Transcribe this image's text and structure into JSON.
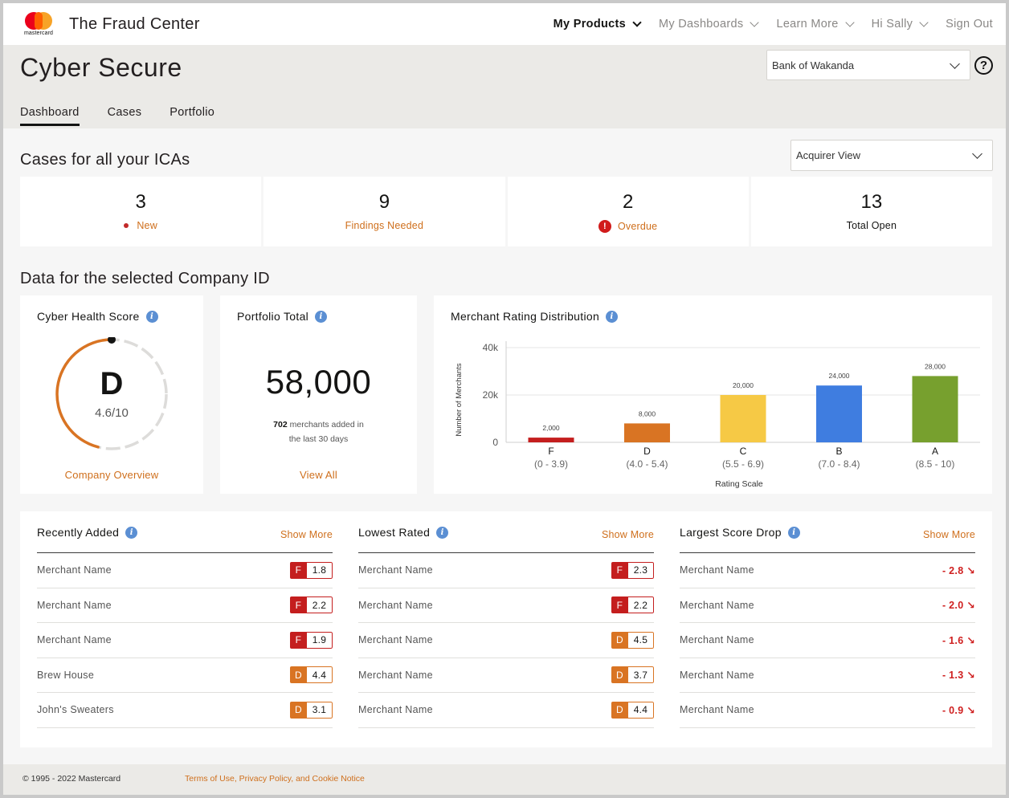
{
  "nav": {
    "logo_word": "mastercard",
    "brand_title": "The Fraud Center",
    "items": [
      {
        "label": "My Products",
        "active": true
      },
      {
        "label": "My Dashboards",
        "active": false
      },
      {
        "label": "Learn More",
        "active": false
      },
      {
        "label": "Hi Sally",
        "active": false
      }
    ],
    "sign_out": "Sign Out"
  },
  "header": {
    "title": "Cyber Secure",
    "bank_select": "Bank of Wakanda",
    "help_icon": "?",
    "tabs": [
      "Dashboard",
      "Cases",
      "Portfolio"
    ]
  },
  "cases": {
    "title": "Cases for all your ICAs",
    "view_select": "Acquirer View",
    "cards": [
      {
        "value": "3",
        "label": "New"
      },
      {
        "value": "9",
        "label": "Findings Needed"
      },
      {
        "value": "2",
        "label": "Overdue"
      },
      {
        "value": "13",
        "label": "Total Open"
      }
    ]
  },
  "company": {
    "title": "Data for the selected Company ID",
    "health": {
      "title": "Cyber Health Score",
      "grade": "D",
      "score_text": "4.6/10",
      "score": 4.6,
      "link": "Company Overview"
    },
    "portfolio": {
      "title": "Portfolio Total",
      "total": "58,000",
      "added_count": "702",
      "added_text": " merchants added in",
      "added_text2": "the last 30 days",
      "link": "View All"
    },
    "distribution": {
      "title": "Merchant Rating Distribution"
    }
  },
  "chart_data": {
    "type": "bar",
    "categories": [
      "F",
      "D",
      "C",
      "B",
      "A"
    ],
    "ranges": [
      "(0 - 3.9)",
      "(4.0 - 5.4)",
      "(5.5 - 6.9)",
      "(7.0 - 8.4)",
      "(8.5 - 10)"
    ],
    "values": [
      2000,
      8000,
      20000,
      24000,
      28000
    ],
    "value_labels": [
      "2,000",
      "8,000",
      "20,000",
      "24,000",
      "28,000"
    ],
    "colors": [
      "#c41e1e",
      "#d97423",
      "#f6c945",
      "#3f7de0",
      "#77a02e"
    ],
    "xlabel": "Rating Scale",
    "ylabel": "Number of Merchants",
    "yticks": [
      "40k",
      "20k",
      "0"
    ],
    "ytick_values": [
      40000,
      20000,
      0
    ],
    "ylim": [
      0,
      40000
    ],
    "grid": true
  },
  "lists": {
    "show_more": "Show More",
    "recent": {
      "title": "Recently Added",
      "rows": [
        {
          "name": "Merchant Name",
          "grade": "F",
          "score": "1.8"
        },
        {
          "name": "Merchant Name",
          "grade": "F",
          "score": "2.2"
        },
        {
          "name": "Merchant Name",
          "grade": "F",
          "score": "1.9"
        },
        {
          "name": "Brew House",
          "grade": "D",
          "score": "4.4"
        },
        {
          "name": "John's Sweaters",
          "grade": "D",
          "score": "3.1"
        }
      ]
    },
    "lowest": {
      "title": "Lowest Rated",
      "rows": [
        {
          "name": "Merchant Name",
          "grade": "F",
          "score": "2.3"
        },
        {
          "name": "Merchant Name",
          "grade": "F",
          "score": "2.2"
        },
        {
          "name": "Merchant Name",
          "grade": "D",
          "score": "4.5"
        },
        {
          "name": "Merchant Name",
          "grade": "D",
          "score": "3.7"
        },
        {
          "name": "Merchant Name",
          "grade": "D",
          "score": "4.4"
        }
      ]
    },
    "drop": {
      "title": "Largest Score Drop",
      "rows": [
        {
          "name": "Merchant Name",
          "drop": "- 2.8 ↘"
        },
        {
          "name": "Merchant Name",
          "drop": "- 2.0 ↘"
        },
        {
          "name": "Merchant Name",
          "drop": "- 1.6 ↘"
        },
        {
          "name": "Merchant Name",
          "drop": "- 1.3 ↘"
        },
        {
          "name": "Merchant Name",
          "drop": "- 0.9 ↘"
        }
      ]
    }
  },
  "grade_colors": {
    "F": "#c41e1e",
    "D": "#d97423"
  },
  "footer": {
    "copyright": "© 1995 - 2022 Mastercard",
    "legal": "Terms of Use, Privacy Policy, and Cookie Notice"
  }
}
